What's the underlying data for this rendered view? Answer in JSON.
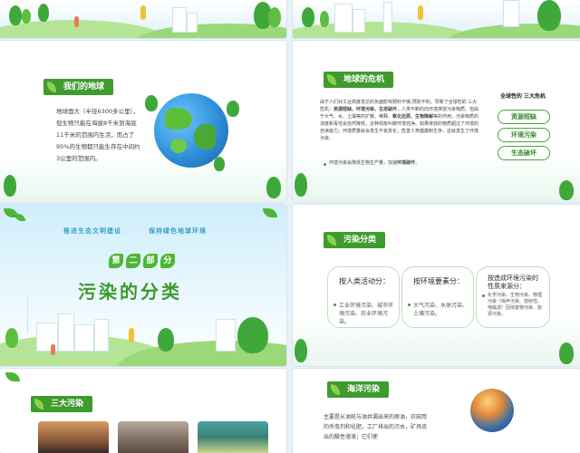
{
  "slide2": {
    "tag": "我们的地球",
    "text": "地球面大（半径6300多公里），但生物只能在海拔8千米到海底11千米的范围内生活，而占了95%的生物都只能生存在中间约3公里的范围内。"
  },
  "slide3": {
    "tag": "地球的危机",
    "text_a": "由于人们对工业高度发达的负面影响预料不够,预防不利，导致了全球性的 三大危机：",
    "crisis_inline": "资源短缺、环境污染、生态破坏",
    "text_b": "，人类不断的向环境排放污染物质。但由于大气、水、土壤等的扩散、稀释、",
    "text_c": "氧化还原、生物降解",
    "text_d": "等的作用，污染物质的浓度和毒性会自然降低，这种现象叫做环境自净。如果排放的物质超过了环境的自净能力，环境质量就会发生不良变化，危害人类健康和生存，这就发生了环境污染。",
    "bullet_a": "环境污染会降低生物生产量，加速",
    "bullet_bold": "环境破坏",
    "bullet_end": "。",
    "side_title": "全球性的 三大危机",
    "pills": [
      "资源短缺",
      "环境污染",
      "生态破坏"
    ]
  },
  "slide4": {
    "slogan_1": "推进生态文明建设",
    "slogan_2": "保持绿色地球环境",
    "part_chars": [
      "第",
      "二",
      "部",
      "分"
    ],
    "title": "污染的分类"
  },
  "slide5": {
    "tag": "污染分类",
    "cards": [
      {
        "head": "按人类活动分：",
        "body": "工业环境污染、城市环境污染、农业环境污染。"
      },
      {
        "head": "按环境要素分：",
        "body": "大气污染、水体污染、土壤污染。"
      },
      {
        "head": "按造成环境污染的性质来源分：",
        "body": "化学污染、生物污染、物理污染（噪声污染、放射性、电磁波）固体废物污染、能源污染。"
      }
    ]
  },
  "slide6": {
    "tag": "三大污染"
  },
  "slide7": {
    "tag": "海洋污染",
    "text": "主要是从油轮与油井漏出来的原油，农田用的杀虫剂和化肥，工厂排出的污水，矿场流出的酸性溶液；它们使"
  },
  "colors": {
    "brand_green": "#3f9b2e",
    "light_green": "#8fd14f",
    "sky": "#dff2fa"
  }
}
